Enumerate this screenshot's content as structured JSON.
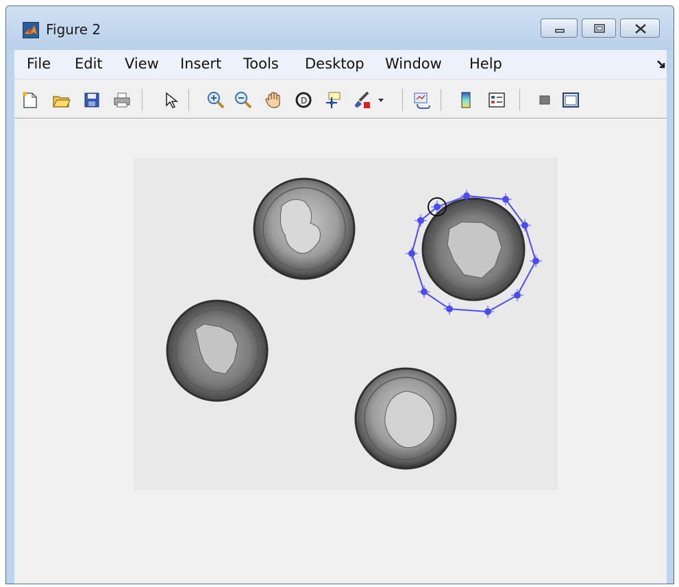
{
  "window": {
    "title": "Figure 2"
  },
  "menubar": {
    "items": [
      {
        "label": "File"
      },
      {
        "label": "Edit"
      },
      {
        "label": "View"
      },
      {
        "label": "Insert"
      },
      {
        "label": "Tools"
      },
      {
        "label": "Desktop"
      },
      {
        "label": "Window"
      },
      {
        "label": "Help"
      }
    ]
  },
  "toolbar": {
    "buttons": [
      "new-figure-icon",
      "open-file-icon",
      "save-icon",
      "print-icon",
      "edit-plot-pointer-icon",
      "zoom-in-icon",
      "zoom-out-icon",
      "pan-hand-icon",
      "rotate-3d-icon",
      "data-cursor-icon",
      "brush-icon",
      "brush-dropdown-icon",
      "link-plot-icon",
      "colorbar-icon",
      "legend-icon",
      "hide-plot-tools-icon",
      "show-plot-tools-icon"
    ]
  },
  "image": {
    "subject": "four coins on a light gray background",
    "roi_color": "#4a4aff",
    "roi_vertex_count": 10
  },
  "colors": {
    "menubar_bg": "#edf2fa",
    "client_bg": "#f0f0f0",
    "titlebar_bg": "#bcd4ec"
  }
}
